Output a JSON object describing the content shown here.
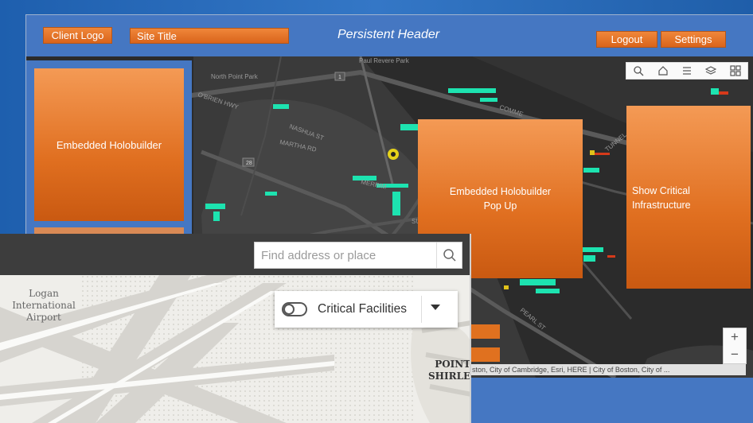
{
  "header": {
    "client_logo": "Client Logo",
    "site_title": "Site Title",
    "persistent_header": "Persistent Header",
    "logout": "Logout",
    "settings": "Settings"
  },
  "panels": {
    "embedded_holobuilder": "Embedded Holobuilder",
    "holobuilder_popup_line1": "Embedded Holobuilder",
    "holobuilder_popup_line2": "Pop Up",
    "critical_line1": "Show Critical",
    "critical_line2": "Infrastructure"
  },
  "map": {
    "attribution": "ston, City of Cambridge, Esri, HERE | City of Boston, City of ...",
    "zoom_in": "+",
    "zoom_out": "−",
    "labels": {
      "north_point": "North Point Park",
      "paul_revere": "Paul Revere Park",
      "martha_rd": "MARTHA RD",
      "commercial": "COMME",
      "obrien_hwy": "O'BRIEN HWY",
      "nashua_st": "NASHUA ST",
      "merrimac": "MERRIM",
      "sudbury": "SUD",
      "tunnel": "TUNNEL",
      "pearl_st": "PEARL ST",
      "route_28": "28",
      "route_1": "1"
    }
  },
  "overlay": {
    "search_placeholder": "Find address or place",
    "airport_line1": "Logan",
    "airport_line2": "International",
    "airport_line3": "Airport",
    "point_line1": "POINT",
    "point_line2": "SHIRLE",
    "layer_label": "Critical Facilities"
  },
  "colors": {
    "header_blue": "#4577c2",
    "accent_orange": "#e0711f",
    "infrastructure_teal": "#1de3b0"
  },
  "icons": [
    "search-icon",
    "home-icon",
    "list-icon",
    "layers-icon",
    "qr-icon"
  ]
}
